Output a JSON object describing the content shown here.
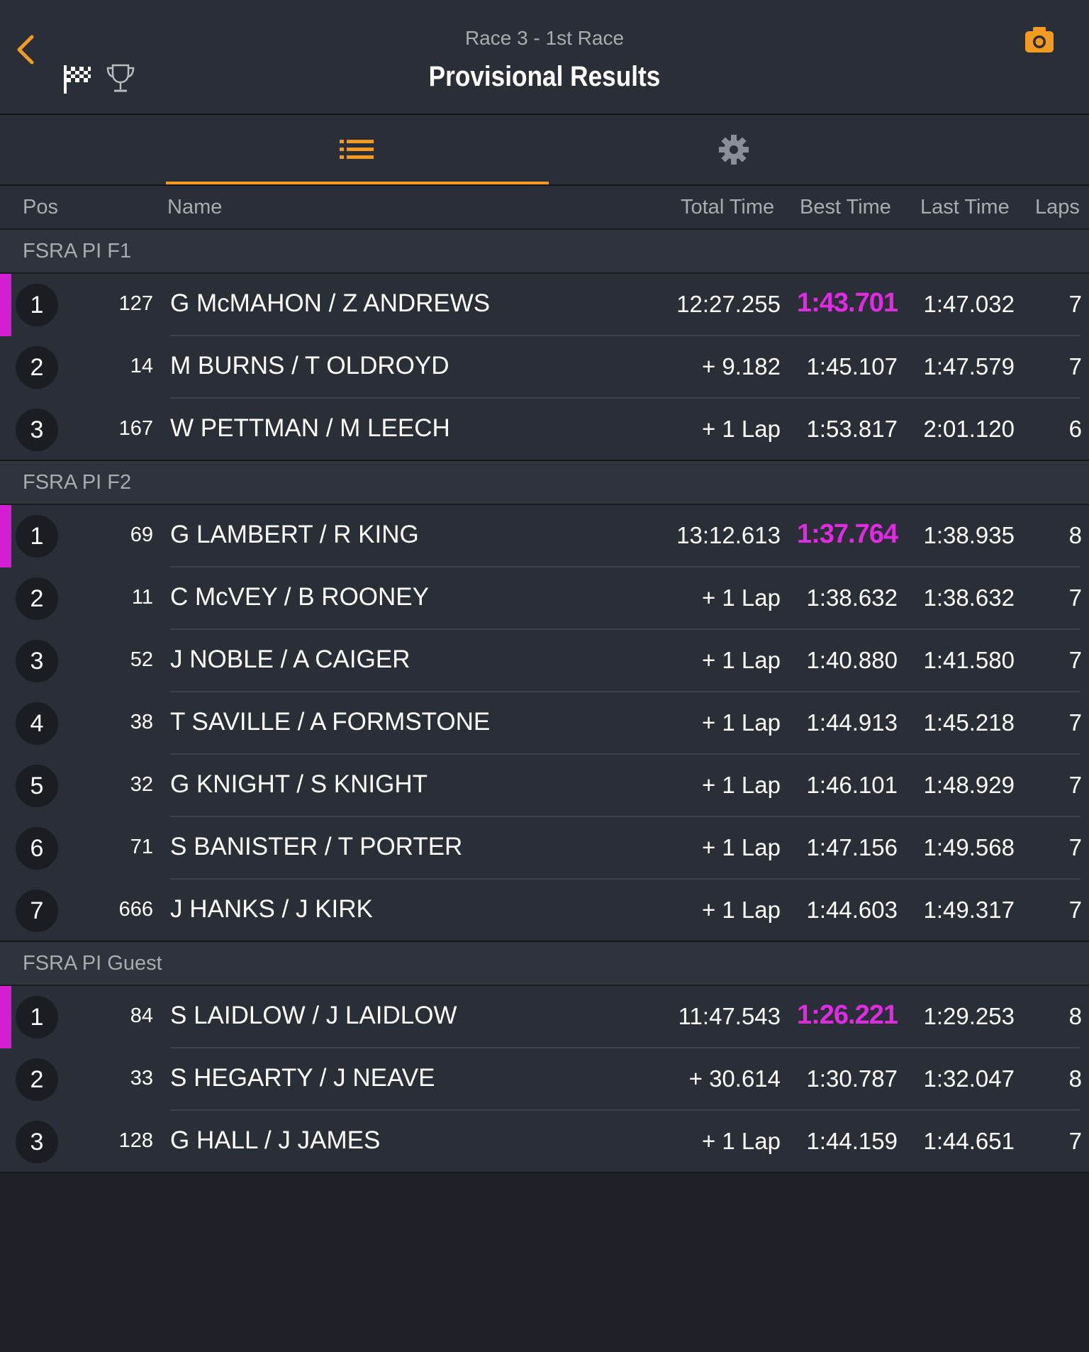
{
  "header": {
    "subtitle": "Race 3 - 1st Race",
    "title": "Provisional Results"
  },
  "colors": {
    "accent": "#f39a21",
    "fastest": "#e02be3",
    "leader_marker": "#d21fd1"
  },
  "icons": [
    "back-chevron-icon",
    "checkered-flag-icon",
    "trophy-icon",
    "camera-icon",
    "list-icon",
    "gear-icon"
  ],
  "columns": {
    "pos": "Pos",
    "name": "Name",
    "total": "Total Time",
    "best": "Best Time",
    "last": "Last Time",
    "laps": "Laps"
  },
  "groups": [
    {
      "title": "FSRA PI F1",
      "rows": [
        {
          "pos": "1",
          "num": "127",
          "name": "G McMAHON / Z ANDREWS",
          "total": "12:27.255",
          "best": "1:43.701",
          "last": "1:47.032",
          "laps": "7",
          "fastest": true
        },
        {
          "pos": "2",
          "num": "14",
          "name": "M BURNS / T OLDROYD",
          "total": "+ 9.182",
          "best": "1:45.107",
          "last": "1:47.579",
          "laps": "7",
          "fastest": false
        },
        {
          "pos": "3",
          "num": "167",
          "name": "W PETTMAN / M LEECH",
          "total": "+ 1 Lap",
          "best": "1:53.817",
          "last": "2:01.120",
          "laps": "6",
          "fastest": false
        }
      ]
    },
    {
      "title": "FSRA PI F2",
      "rows": [
        {
          "pos": "1",
          "num": "69",
          "name": "G LAMBERT / R KING",
          "total": "13:12.613",
          "best": "1:37.764",
          "last": "1:38.935",
          "laps": "8",
          "fastest": true
        },
        {
          "pos": "2",
          "num": "11",
          "name": "C McVEY / B ROONEY",
          "total": "+ 1 Lap",
          "best": "1:38.632",
          "last": "1:38.632",
          "laps": "7",
          "fastest": false
        },
        {
          "pos": "3",
          "num": "52",
          "name": "J NOBLE / A CAIGER",
          "total": "+ 1 Lap",
          "best": "1:40.880",
          "last": "1:41.580",
          "laps": "7",
          "fastest": false
        },
        {
          "pos": "4",
          "num": "38",
          "name": "T SAVILLE / A FORMSTONE",
          "total": "+ 1 Lap",
          "best": "1:44.913",
          "last": "1:45.218",
          "laps": "7",
          "fastest": false
        },
        {
          "pos": "5",
          "num": "32",
          "name": "G KNIGHT / S KNIGHT",
          "total": "+ 1 Lap",
          "best": "1:46.101",
          "last": "1:48.929",
          "laps": "7",
          "fastest": false
        },
        {
          "pos": "6",
          "num": "71",
          "name": "S BANISTER / T PORTER",
          "total": "+ 1 Lap",
          "best": "1:47.156",
          "last": "1:49.568",
          "laps": "7",
          "fastest": false
        },
        {
          "pos": "7",
          "num": "666",
          "name": "J HANKS / J KIRK",
          "total": "+ 1 Lap",
          "best": "1:44.603",
          "last": "1:49.317",
          "laps": "7",
          "fastest": false
        }
      ]
    },
    {
      "title": "FSRA PI Guest",
      "rows": [
        {
          "pos": "1",
          "num": "84",
          "name": "S LAIDLOW / J LAIDLOW",
          "total": "11:47.543",
          "best": "1:26.221",
          "last": "1:29.253",
          "laps": "8",
          "fastest": true
        },
        {
          "pos": "2",
          "num": "33",
          "name": "S HEGARTY / J NEAVE",
          "total": "+ 30.614",
          "best": "1:30.787",
          "last": "1:32.047",
          "laps": "8",
          "fastest": false
        },
        {
          "pos": "3",
          "num": "128",
          "name": "G HALL / J JAMES",
          "total": "+ 1 Lap",
          "best": "1:44.159",
          "last": "1:44.651",
          "laps": "7",
          "fastest": false
        }
      ]
    }
  ]
}
